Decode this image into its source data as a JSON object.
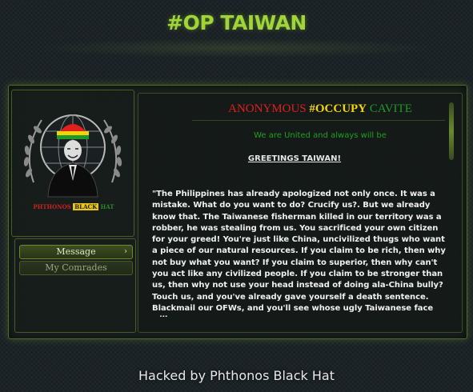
{
  "page": {
    "title": "#OP TAIWAN",
    "footer": "Hacked by Phthonos Black Hat"
  },
  "logo": {
    "text_part1": "PHTHONOS",
    "text_part2": "BLACK",
    "text_part3": "HAT",
    "icon": "anonymous-emblem-icon"
  },
  "nav": {
    "items": [
      {
        "label": "Message",
        "active": true
      },
      {
        "label": "My Comrades",
        "active": false
      }
    ],
    "chevron_icon": "chevron-right-icon"
  },
  "content": {
    "banner_part1": "ANONYMOUS ",
    "banner_part2": "#OCCUPY",
    "banner_part3": " CAVITE",
    "subtitle": "We are United and always will be",
    "greeting": "GREETINGS TAIWAN!",
    "body": "\"The Philippines has already apologized not only once. It was a mistake. What do you want to do? Crucify us?. But we already know that. The Taiwanese fisherman killed in our territory was a robber, he was stealing from us. You sacrificed your own citizen for your greed! You're just like China, uncivilized thugs who want a piece of our natural resources. If you claim to be rich, then why not buy what you want? If you claim to superior, then why can't you act like any civilized people. If you claim to be stronger than us, then why not use your head instead of doing ala-China bully? Touch us, and you've already gave yourself a death sentence. Blackmail our OFWs, and you'll see whose ugly Taiwanese face will"
  },
  "colors": {
    "title_green": "#a3d33a",
    "red": "#e0201c",
    "yellow": "#f2d40d",
    "green": "#1f9a2a"
  }
}
